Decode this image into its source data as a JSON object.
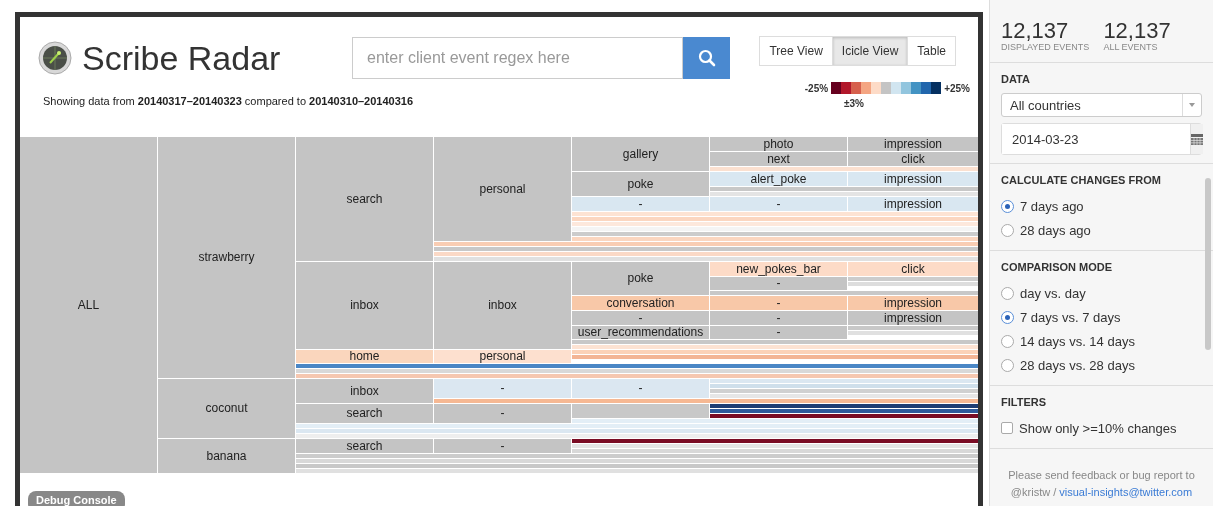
{
  "header": {
    "title": "Scribe Radar",
    "search": {
      "placeholder": "enter client event regex here"
    },
    "subtitle": "Showing data from **20140317–20140323** compared to **20140310–20140316**",
    "views": [
      {
        "label": "Tree View",
        "selected": false
      },
      {
        "label": "Icicle View",
        "selected": true
      },
      {
        "label": "Table",
        "selected": false
      }
    ],
    "legend": {
      "low": "-25%",
      "high": "+25%",
      "middle": "±3%",
      "swatches": [
        {
          "color": "#67001f"
        },
        {
          "color": "#b2182b"
        },
        {
          "color": "#d6604d"
        },
        {
          "color": "#f4a582"
        },
        {
          "color": "#fddbc7"
        },
        {
          "color": "#c4c4c4"
        },
        {
          "color": "#d1e5f0"
        },
        {
          "color": "#92c5de"
        },
        {
          "color": "#4393c3"
        },
        {
          "color": "#2166ac"
        },
        {
          "color": "#053061"
        }
      ]
    }
  },
  "icicle": {
    "label": "ALL",
    "color": "#c4c4c4",
    "children": [
      {
        "label": "strawberry",
        "color": "#c4c4c4",
        "children": [
          {
            "label": "search",
            "color": "#c4c4c4",
            "children": [
              {
                "label": "personal",
                "color": "#c4c4c4",
                "children": [
                  {
                    "label": "gallery",
                    "color": "#c4c4c4",
                    "children": [
                      {
                        "label": "photo",
                        "color": "#c4c4c4",
                        "children": [
                          {
                            "label": "impression",
                            "color": "#c4c4c4"
                          }
                        ]
                      },
                      {
                        "label": "next",
                        "color": "#c4c4c4",
                        "children": [
                          {
                            "label": "click",
                            "color": "#c4c4c4"
                          }
                        ]
                      },
                      {
                        "color": "#fbe0d0"
                      }
                    ]
                  },
                  {
                    "label": "poke",
                    "color": "#c4c4c4",
                    "children": [
                      {
                        "label": "alert_poke",
                        "color": "#d9e7f1",
                        "children": [
                          {
                            "label": "impression",
                            "color": "#d9e7f1"
                          }
                        ]
                      },
                      {
                        "color": "#c8c8c8"
                      },
                      {
                        "color": "#e4e4e4"
                      }
                    ]
                  },
                  {
                    "label": "-",
                    "color": "#d9e7f1",
                    "children": [
                      {
                        "label": "-",
                        "color": "#d9e7f1",
                        "children": [
                          {
                            "label": "impression",
                            "color": "#d9e7f1"
                          }
                        ]
                      }
                    ]
                  },
                  {
                    "color": "#fde3d3"
                  },
                  {
                    "color": "#fbd6c0"
                  },
                  {
                    "color": "#fde8dc"
                  },
                  {
                    "color": "#f4f4f4"
                  },
                  {
                    "color": "#cccccc"
                  },
                  {
                    "color": "#fbd6c0"
                  }
                ]
              },
              {
                "color": "#f9cdb3"
              },
              {
                "color": "#c8c8c8"
              },
              {
                "color": "#fbd9c6"
              },
              {
                "color": "#e0e0e0"
              }
            ]
          },
          {
            "label": "inbox",
            "color": "#c4c4c4",
            "children": [
              {
                "label": "inbox",
                "color": "#c4c4c4",
                "children": [
                  {
                    "label": "poke",
                    "color": "#c4c4c4",
                    "children": [
                      {
                        "label": "new_pokes_bar",
                        "color": "#fddbc7",
                        "children": [
                          {
                            "label": "click",
                            "color": "#fddbc7"
                          }
                        ]
                      },
                      {
                        "label": "-",
                        "color": "#c4c4c4",
                        "children": [
                          {
                            "color": "#cccccc"
                          },
                          {
                            "color": "#dddddd"
                          }
                        ]
                      },
                      {
                        "color": "#c8c8c8"
                      }
                    ]
                  },
                  {
                    "label": "conversation",
                    "color": "#f8c8a8",
                    "children": [
                      {
                        "label": "-",
                        "color": "#f8c8a8",
                        "children": [
                          {
                            "label": "impression",
                            "color": "#f8c8a8"
                          }
                        ]
                      }
                    ]
                  },
                  {
                    "label": "-",
                    "color": "#c4c4c4",
                    "children": [
                      {
                        "label": "-",
                        "color": "#c4c4c4",
                        "children": [
                          {
                            "label": "impression",
                            "color": "#c4c4c4"
                          }
                        ]
                      }
                    ]
                  },
                  {
                    "label": "user_recommendations",
                    "color": "#c4c4c4",
                    "children": [
                      {
                        "label": "-",
                        "color": "#c4c4c4",
                        "children": [
                          {
                            "color": "#c8c8c8"
                          },
                          {
                            "color": "#e0e0e0"
                          }
                        ]
                      }
                    ]
                  },
                  {
                    "color": "#c8c8c8"
                  },
                  {
                    "color": "#fde3d3"
                  }
                ]
              }
            ]
          },
          {
            "label": "home",
            "color": "#fad6bd",
            "children": [
              {
                "label": "personal",
                "color": "#fde0cf",
                "children": [
                  {
                    "color": "#fbd2b8"
                  },
                  {
                    "color": "#f3b595"
                  }
                ]
              }
            ]
          },
          {
            "color": "#4a86c5"
          },
          {
            "color": "#d8d8d8"
          },
          {
            "color": "#f5c7b0"
          }
        ]
      },
      {
        "label": "coconut",
        "color": "#c4c4c4",
        "children": [
          {
            "label": "inbox",
            "color": "#c4c4c4",
            "children": [
              {
                "label": "-",
                "color": "#dbe7f1",
                "children": [
                  {
                    "label": "-",
                    "color": "#dbe7f1",
                    "children": [
                      {
                        "color": "#dbe7f1"
                      },
                      {
                        "color": "#cfdfeb"
                      },
                      {
                        "color": "#d0d0d0"
                      },
                      {
                        "color": "#e6e6e6"
                      }
                    ]
                  }
                ]
              },
              {
                "color": "#f6b893"
              }
            ]
          },
          {
            "label": "search",
            "color": "#c4c4c4",
            "children": [
              {
                "label": "-",
                "color": "#c4c4c4",
                "children": [
                  {
                    "color": "#c8c8c8",
                    "children": [
                      {
                        "color": "#1f3d73"
                      },
                      {
                        "color": "#2f5a9a"
                      },
                      {
                        "color": "#7a0c24"
                      }
                    ]
                  },
                  {
                    "color": "#e3eef6"
                  }
                ]
              }
            ]
          },
          {
            "color": "#e3eef6"
          },
          {
            "color": "#dbe7f1"
          },
          {
            "color": "#eeeeee"
          }
        ]
      },
      {
        "label": "banana",
        "color": "#c4c4c4",
        "children": [
          {
            "label": "search",
            "color": "#c4c4c4",
            "children": [
              {
                "label": "-",
                "color": "#c4c4c4",
                "children": [
                  {
                    "color": "#7a0c24"
                  },
                  {
                    "color": "#e4e4e4"
                  },
                  {
                    "color": "#d8d8d8"
                  }
                ]
              }
            ]
          },
          {
            "color": "#cccccc"
          },
          {
            "color": "#d8d8d8"
          },
          {
            "color": "#c8c8c8"
          },
          {
            "color": "#e0e0e0"
          }
        ]
      }
    ]
  },
  "debug_button": "Debug Console",
  "sidebar": {
    "stats": [
      {
        "value": "12,137",
        "label": "DISPLAYED EVENTS"
      },
      {
        "value": "12,137",
        "label": "ALL EVENTS"
      }
    ],
    "data": {
      "heading": "DATA",
      "country": "All countries",
      "date": "2014-03-23"
    },
    "changes_from": {
      "heading": "CALCULATE CHANGES FROM",
      "options": [
        {
          "label": "7 days ago",
          "selected": true
        },
        {
          "label": "28 days ago",
          "selected": false
        }
      ]
    },
    "comparison": {
      "heading": "COMPARISON MODE",
      "options": [
        {
          "label": "day vs. day",
          "selected": false
        },
        {
          "label": "7 days vs. 7 days",
          "selected": true
        },
        {
          "label": "14 days vs. 14 days",
          "selected": false
        },
        {
          "label": "28 days vs. 28 days",
          "selected": false
        }
      ]
    },
    "filters": {
      "heading": "FILTERS",
      "checkbox": {
        "label": "Show only >=10% changes",
        "checked": false
      }
    },
    "footer": {
      "text": "Please send feedback or bug report to",
      "handle": "@kristw /",
      "link": "visual-insights@twitter.com"
    }
  }
}
